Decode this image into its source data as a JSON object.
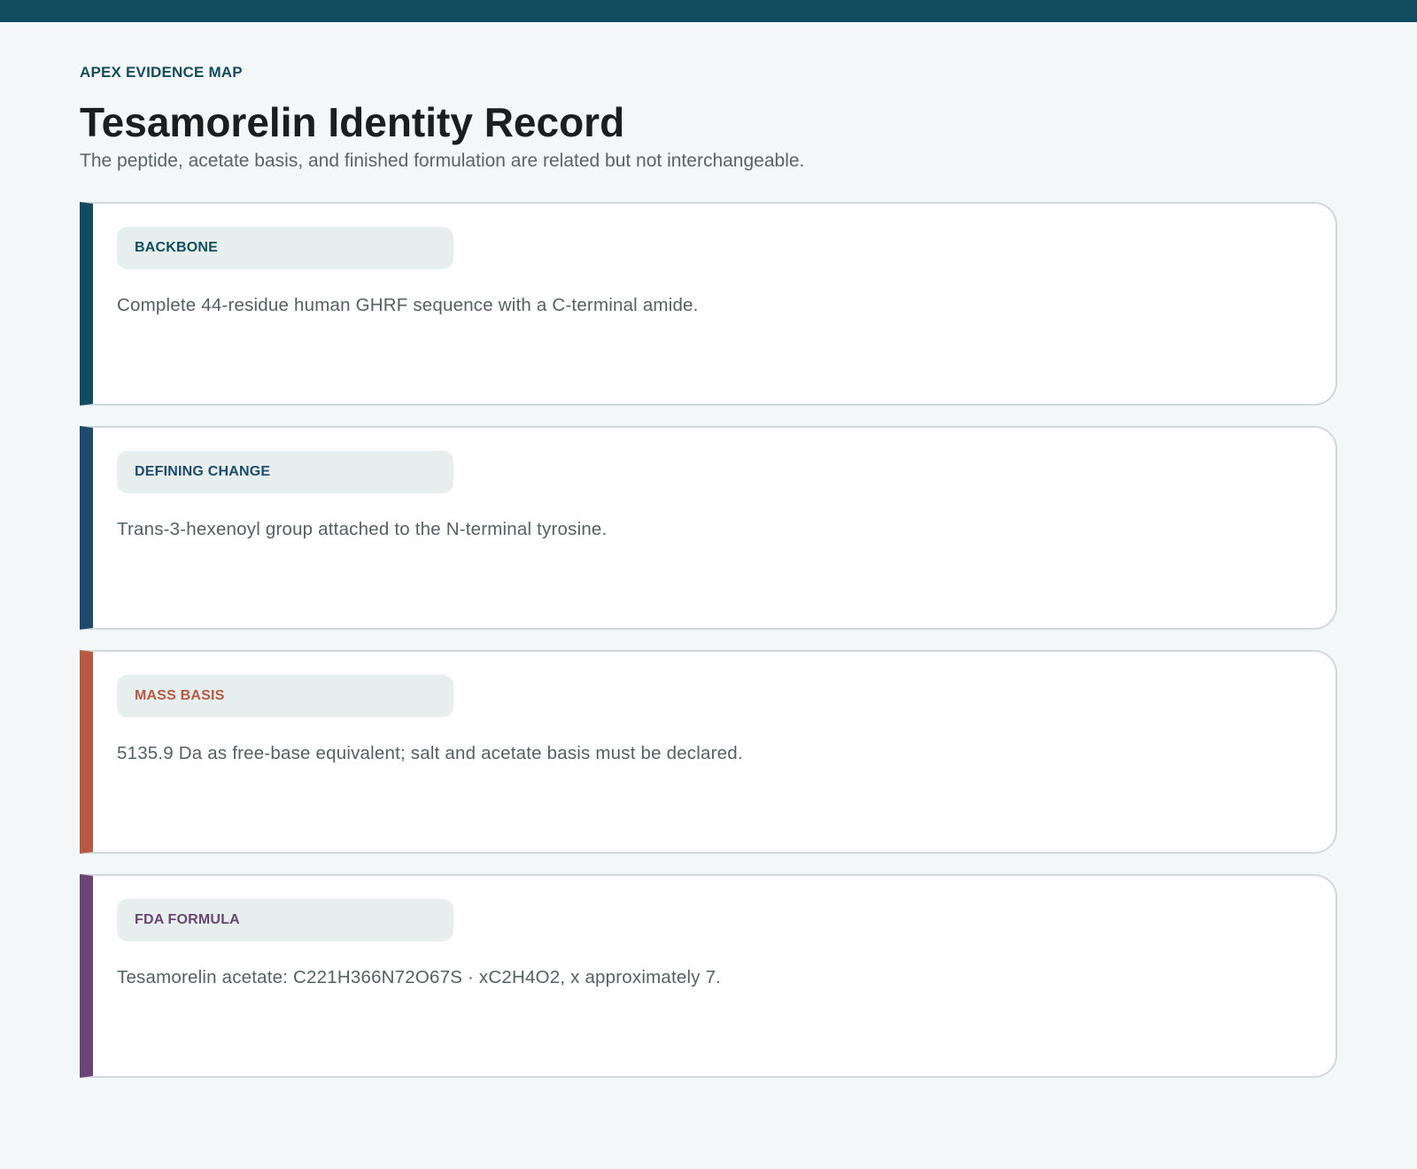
{
  "header": {
    "eyebrow": "APEX EVIDENCE MAP",
    "title": "Tesamorelin Identity Record",
    "subtitle": "The peptide, acetate basis, and finished formulation are related but not interchangeable."
  },
  "cards": [
    {
      "label": "BACKBONE",
      "text": "Complete 44-residue human GHRF sequence with a C-terminal amide.",
      "accent_color": "#114d5e"
    },
    {
      "label": "DEFINING CHANGE",
      "text": "Trans-3-hexenoyl group attached to the N-terminal tyrosine.",
      "accent_color": "#1e4b6d"
    },
    {
      "label": "MASS BASIS",
      "text": "5135.9 Da as free-base equivalent; salt and acetate basis must be declared.",
      "accent_color": "#b85a43"
    },
    {
      "label": "FDA FORMULA",
      "text": "Tesamorelin acetate: C221H366N72O67S · xC2H4O2, x approximately 7.",
      "accent_color": "#6b4576"
    }
  ],
  "colors": {
    "topbar": "#114d5e",
    "background": "#f3f7f8"
  }
}
